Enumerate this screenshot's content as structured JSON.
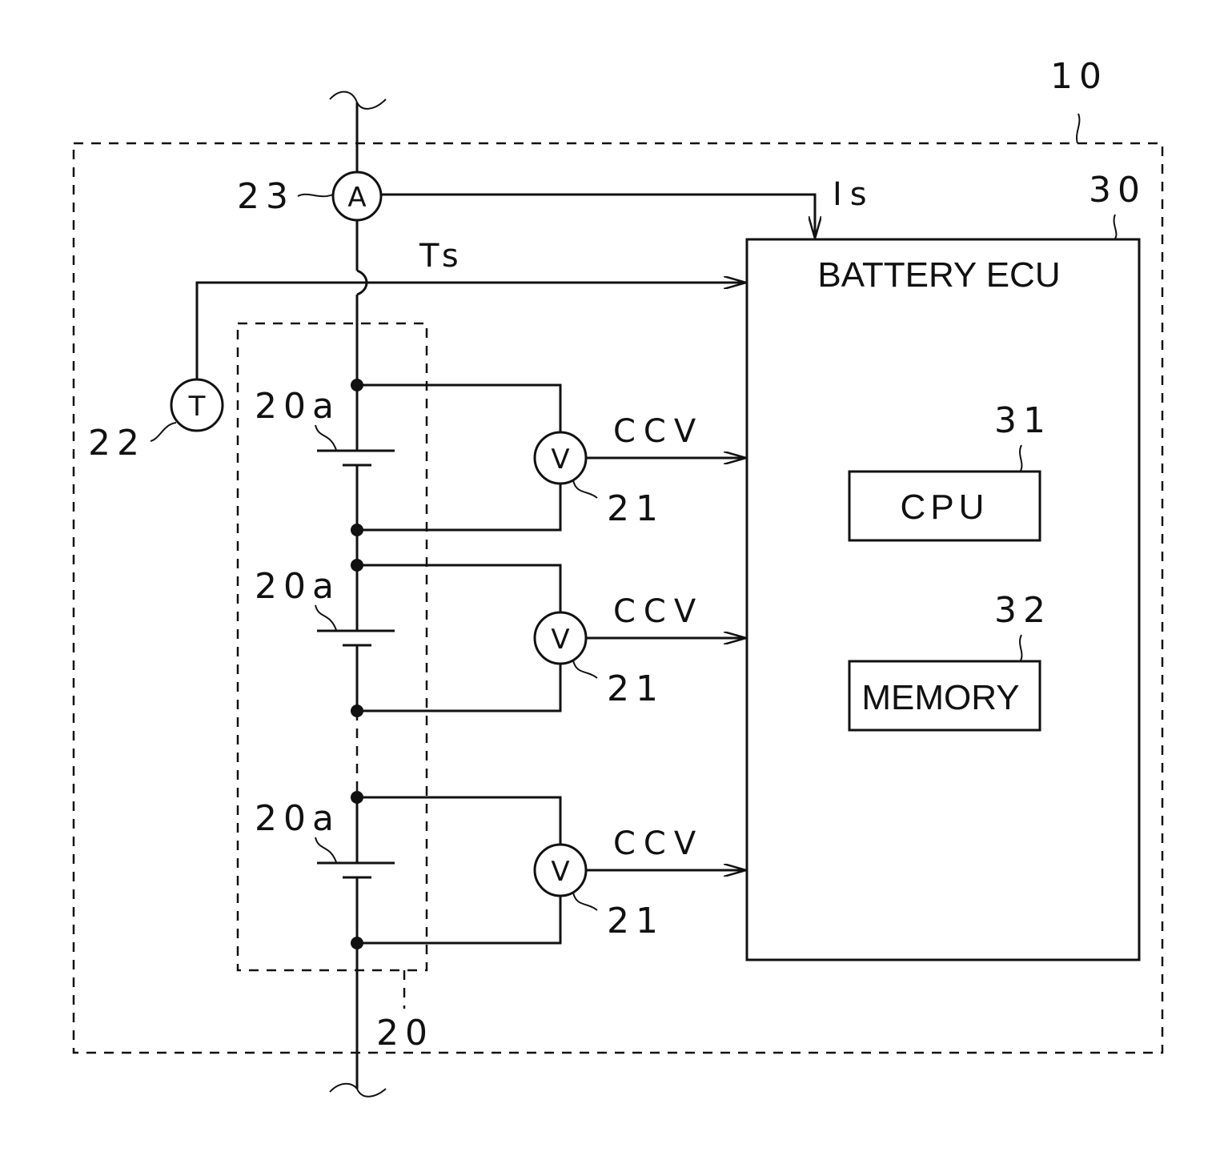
{
  "figure": {
    "system_ref": "10",
    "ecu": {
      "ref": "30",
      "title": "BATTERY ECU"
    },
    "cpu": {
      "ref": "31",
      "label": "CPU"
    },
    "memory": {
      "ref": "32",
      "label": "MEMORY"
    },
    "battery_pack": {
      "ref": "20"
    },
    "cells": [
      {
        "ref": "20a",
        "signal": "CCV",
        "sensor_ref": "21",
        "sensor_symbol": "V"
      },
      {
        "ref": "20a",
        "signal": "CCV",
        "sensor_ref": "21",
        "sensor_symbol": "V"
      },
      {
        "ref": "20a",
        "signal": "CCV",
        "sensor_ref": "21",
        "sensor_symbol": "V"
      }
    ],
    "temperature_sensor": {
      "ref": "22",
      "symbol": "T",
      "signal": "Ts"
    },
    "current_sensor": {
      "ref": "23",
      "symbol": "A",
      "signal": "Is"
    }
  }
}
